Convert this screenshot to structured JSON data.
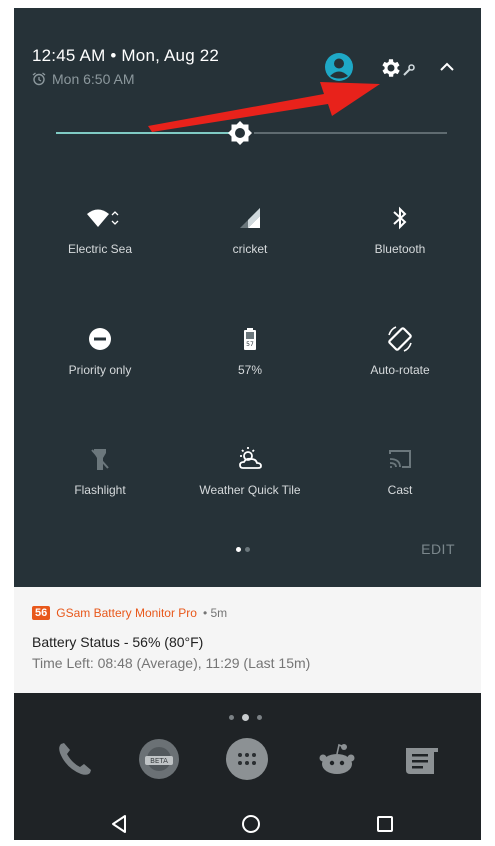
{
  "header": {
    "datetime": "12:45 AM • Mon, Aug 22",
    "alarm": "Mon 6:50 AM",
    "icons": [
      "alarm-clock-icon",
      "account-icon",
      "settings-gear-icon",
      "wrench-icon",
      "collapse-chevron-icon"
    ]
  },
  "brightness": {
    "level": 0.47,
    "icon": "brightness-icon"
  },
  "tiles": [
    {
      "label": "Electric Sea",
      "icon": "wifi-icon"
    },
    {
      "label": "cricket",
      "icon": "cell-signal-icon"
    },
    {
      "label": "Bluetooth",
      "icon": "bluetooth-icon"
    },
    {
      "label": "Priority only",
      "icon": "do-not-disturb-icon"
    },
    {
      "label": "57%",
      "icon": "battery-icon"
    },
    {
      "label": "Auto-rotate",
      "icon": "auto-rotate-icon"
    },
    {
      "label": "Flashlight",
      "icon": "flashlight-icon"
    },
    {
      "label": "Weather Quick Tile",
      "icon": "weather-icon"
    },
    {
      "label": "Cast",
      "icon": "cast-icon"
    }
  ],
  "edit_label": "EDIT",
  "notification": {
    "badge": "56",
    "app": "GSam Battery Monitor Pro",
    "time": "• 5m",
    "title": "Battery Status - 56% (80°F)",
    "text": "Time Left: 08:48 (Average), 11:29 (Last 15m)"
  },
  "dock": {
    "apps": [
      "phone-icon",
      "reddit-beta-icon",
      "app-drawer-icon",
      "reddit-alien-icon",
      "news-icon"
    ],
    "beta_label": "BETA"
  },
  "navbar": [
    "back-icon",
    "home-icon",
    "recents-icon"
  ],
  "colors": {
    "panel_bg": "#263238",
    "accent": "#80cbc4",
    "annotation_arrow": "#e8221b",
    "notification_app": "#e8581b"
  }
}
